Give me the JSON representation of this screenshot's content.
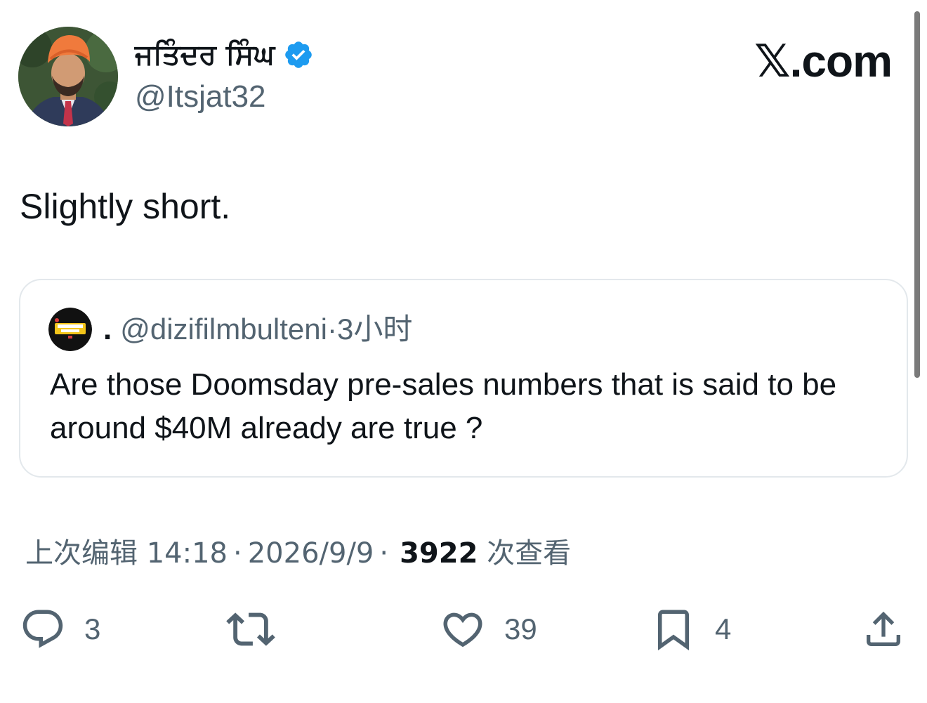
{
  "author": {
    "display_name": "ਜਤਿੰਦਰ ਸਿੰਘ",
    "handle": "@Itsjat32",
    "avatar_icon": "profile-avatar-turban",
    "verified_icon": "verified-badge-icon"
  },
  "brand": {
    "label": "𝕏.com"
  },
  "tweet": {
    "text": "Slightly short."
  },
  "quote": {
    "name_label": ".",
    "handle_time": "@dizifilmbulteni·3小时",
    "text": "Are those Doomsday pre-sales numbers that is said to be around $40M already are true ?",
    "avatar_icon": "dizi-film-bulteni-logo"
  },
  "meta": {
    "edited_time": "上次编辑 14:18",
    "separator1": "·",
    "date": "2026/9/9",
    "separator2": "·",
    "views_count": "3922",
    "views_label": "次查看"
  },
  "actions": {
    "reply_count": "3",
    "retweet_count": "",
    "like_count": "39",
    "bookmark_count": "4"
  },
  "colors": {
    "text_primary": "#0f1419",
    "text_secondary": "#536471",
    "verified_blue": "#1d9bf0",
    "border": "#e3e8ec"
  }
}
